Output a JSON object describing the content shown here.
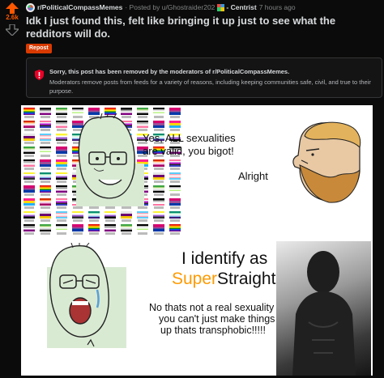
{
  "vote": {
    "score": "2.6k"
  },
  "post": {
    "subreddit": "r/PoliticalCompassMemes",
    "posted_by": "· Posted by u/Ghostraider202",
    "flair": "- Centrist",
    "time": "7 hours ago",
    "title": "Idk I just found this, felt like bringing it up just to see what the redditors will do.",
    "tag": "Repost"
  },
  "removed": {
    "heading": "Sorry, this post has been removed by the moderators of r/PoliticalCompassMemes.",
    "body": "Moderators remove posts from feeds for a variety of reasons, including keeping communities safe, civil, and true to their purpose."
  },
  "meme": {
    "panel1_line1": "Yes, ALL sexualities",
    "panel1_line2": "are valid, you bigot!",
    "panel2": "Alright",
    "panel3_line1": "I identify as",
    "panel3_super": "Super",
    "panel3_straight": "Straight",
    "panel4_line1": "No thats not a real sexuality",
    "panel4_line2": "you can't just make things",
    "panel4_line3": "up thats transphobic!!!!!"
  },
  "colors": {
    "upvote": "#ff5700",
    "accent_super": "#ff9a00",
    "tag_bg": "#d93a00",
    "removed_shield": "#ea0027"
  },
  "icons": [
    "upvote-arrow-icon",
    "downvote-arrow-icon",
    "shield-icon"
  ]
}
